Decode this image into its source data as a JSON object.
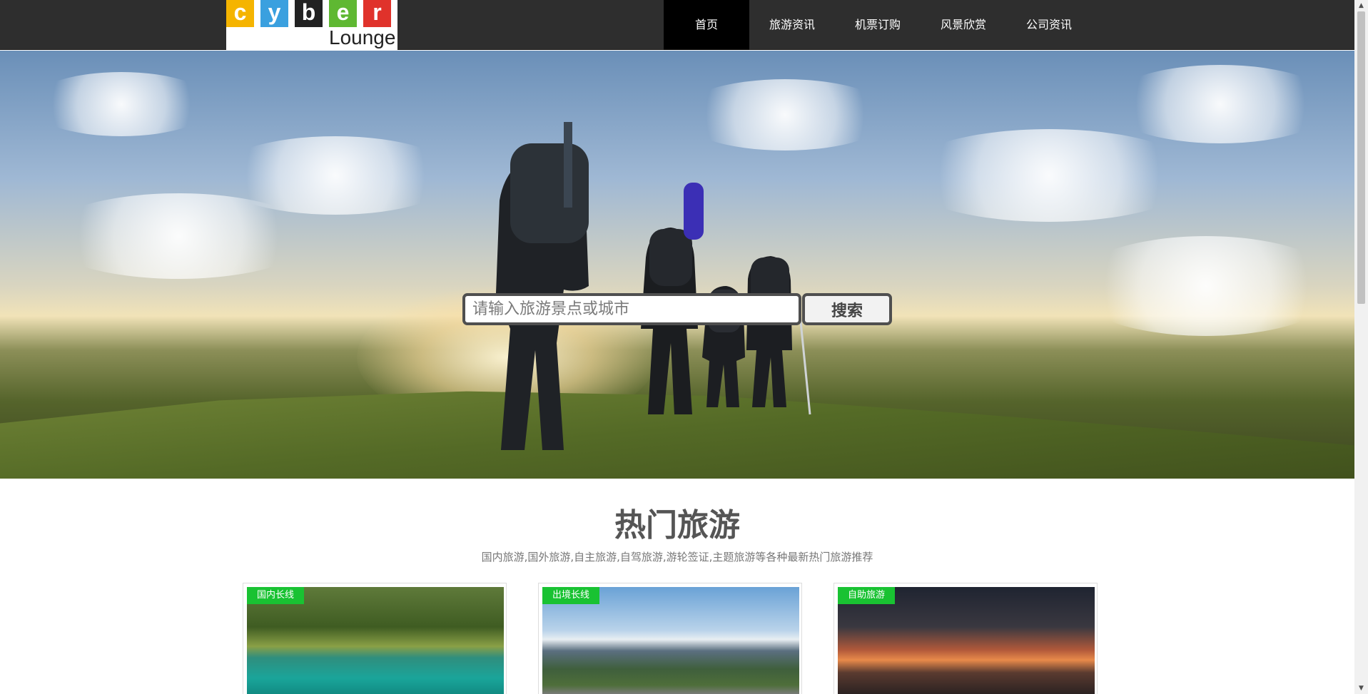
{
  "logo": {
    "letters": [
      "c",
      "y",
      "b",
      "e",
      "r"
    ],
    "letter_colors": [
      "#f5b400",
      "#3aa0df",
      "#222222",
      "#5fb832",
      "#e0322b"
    ],
    "subtitle": "Lounge"
  },
  "nav": {
    "items": [
      {
        "label": "首页",
        "active": true
      },
      {
        "label": "旅游资讯",
        "active": false
      },
      {
        "label": "机票订购",
        "active": false
      },
      {
        "label": "风景欣赏",
        "active": false
      },
      {
        "label": "公司资讯",
        "active": false
      }
    ]
  },
  "search": {
    "placeholder": "请输入旅游景点或城市",
    "button_label": "搜索"
  },
  "hot": {
    "title": "热门旅游",
    "subtitle": "国内旅游,国外旅游,自主旅游,自驾旅游,游轮签证,主题旅游等各种最新热门旅游推荐",
    "cards": [
      {
        "tag": "国内长线"
      },
      {
        "tag": "出境长线"
      },
      {
        "tag": "自助旅游"
      }
    ]
  },
  "colors": {
    "header_bg": "#2e2e2e",
    "tag_green": "#19c232"
  },
  "icons": [
    "scroll-up-arrow-icon",
    "scroll-down-arrow-icon"
  ]
}
